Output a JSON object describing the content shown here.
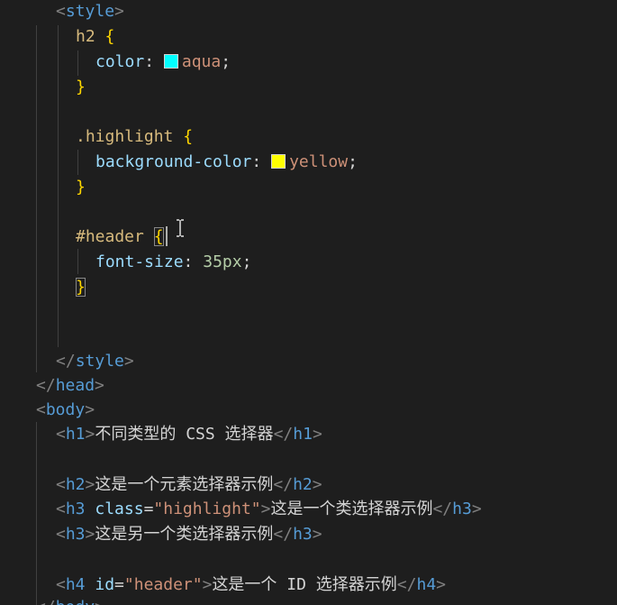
{
  "colors": {
    "background": "#1e1e1e",
    "aqua_swatch": "#00ffff",
    "yellow_swatch": "#ffff00"
  },
  "lines": {
    "l1": {
      "open": "<",
      "tag": "style",
      "close": ">"
    },
    "l2": {
      "sel": "h2",
      "brace": " {"
    },
    "l3": {
      "prop": "color",
      "colon": ": ",
      "val": "aqua",
      "semi": ";"
    },
    "l4": {
      "brace": "}"
    },
    "l6": {
      "sel": ".highlight",
      "brace": " {"
    },
    "l7": {
      "prop": "background-color",
      "colon": ": ",
      "val": "yellow",
      "semi": ";"
    },
    "l8": {
      "brace": "}"
    },
    "l10": {
      "sel": "#header",
      "space": " ",
      "brace": "{"
    },
    "l11": {
      "prop": "font-size",
      "colon": ": ",
      "num": "35px",
      "semi": ";"
    },
    "l12": {
      "brace": "}"
    },
    "l15": {
      "open": "</",
      "tag": "style",
      "close": ">"
    },
    "l16": {
      "open": "</",
      "tag": "head",
      "close": ">"
    },
    "l17": {
      "open": "<",
      "tag": "body",
      "close": ">"
    },
    "l18": {
      "open": "<",
      "tag": "h1",
      "close": ">",
      "text": "不同类型的 CSS 选择器",
      "end_open": "</",
      "end_tag": "h1",
      "end_close": ">"
    },
    "l20": {
      "open": "<",
      "tag": "h2",
      "close": ">",
      "text": "这是一个元素选择器示例",
      "end_open": "</",
      "end_tag": "h2",
      "end_close": ">"
    },
    "l21": {
      "open": "<",
      "tag": "h3",
      "attr": " class",
      "eq": "=",
      "str": "\"highlight\"",
      "close": ">",
      "text": "这是一个类选择器示例",
      "end_open": "</",
      "end_tag": "h3",
      "end_close": ">"
    },
    "l22": {
      "open": "<",
      "tag": "h3",
      "close": ">",
      "text": "这是另一个类选择器示例",
      "end_open": "</",
      "end_tag": "h3",
      "end_close": ">"
    },
    "l24": {
      "open": "<",
      "tag": "h4",
      "attr": " id",
      "eq": "=",
      "str": "\"header\"",
      "close": ">",
      "text": "这是一个 ID 选择器示例",
      "end_open": "</",
      "end_tag": "h4",
      "end_close": ">"
    },
    "l25": {
      "open": "</",
      "tag": "body",
      "close": ">"
    }
  }
}
